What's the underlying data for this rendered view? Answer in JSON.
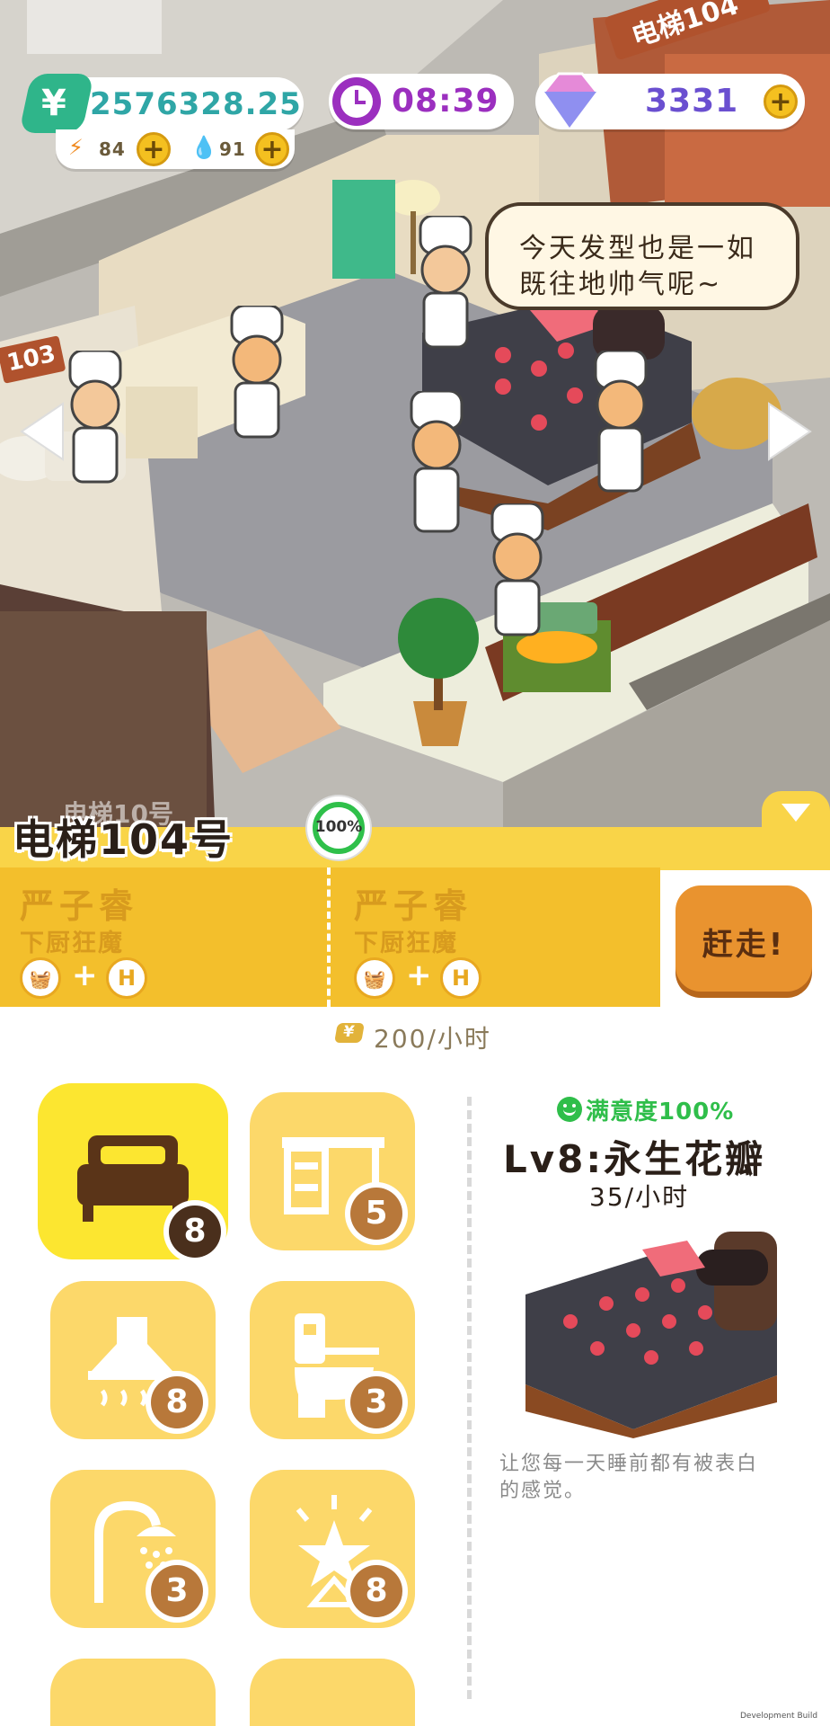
{
  "hud": {
    "money": "2576328.25",
    "currency_symbol": "¥",
    "time": "08:39",
    "gems": "3331",
    "energy": "84",
    "water": "91",
    "plus": "+"
  },
  "scene": {
    "elevator_sign": "电梯104",
    "left_room_sign": "103",
    "speech_line1": "今天发型也是一如",
    "speech_line2": "既往地帅气呢~",
    "behind_banner_text": "电梯10号"
  },
  "room": {
    "title": "电梯104号",
    "progress": "100%"
  },
  "occupants": [
    {
      "name": "严子睿",
      "title": "下厨狂魔",
      "icon_a": "🧺",
      "icon_b": "H"
    },
    {
      "name": "严子睿",
      "title": "下厨狂魔",
      "icon_a": "🧺",
      "icon_b": "H"
    }
  ],
  "evict_label": "赶走!",
  "rate": {
    "symbol": "¥",
    "text": "200/小时"
  },
  "categories": [
    {
      "name": "bed",
      "level": "8",
      "selected": true
    },
    {
      "name": "desk",
      "level": "5",
      "selected": false
    },
    {
      "name": "range-hood",
      "level": "8",
      "selected": false
    },
    {
      "name": "toilet",
      "level": "3",
      "selected": false
    },
    {
      "name": "shower",
      "level": "3",
      "selected": false
    },
    {
      "name": "light-decor",
      "level": "8",
      "selected": false
    }
  ],
  "detail": {
    "satisfaction": "满意度100%",
    "item_name": "Lv8:永生花瓣",
    "income": "35/小时",
    "description_line1": "让您每一天睡前都有被表白",
    "description_line2": "的感觉。"
  },
  "watermark": "Development Build",
  "colors": {
    "accent_yellow": "#f9d448",
    "ticket": "#f3bf2c",
    "money_green": "#2fb58a",
    "clock_purple": "#9b2fbf",
    "gem_purple": "#6a4fd0",
    "badge_brown": "#b8783a"
  }
}
